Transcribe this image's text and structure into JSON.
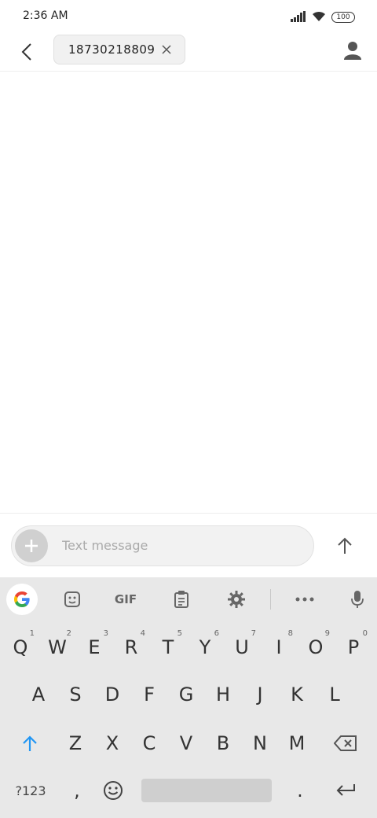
{
  "status": {
    "time": "2:36 AM",
    "battery": "100"
  },
  "header": {
    "recipient": "18730218809"
  },
  "compose": {
    "placeholder": "Text message"
  },
  "keyboard": {
    "toolbar": {
      "gif_label": "GIF"
    },
    "row1": [
      {
        "label": "Q",
        "hint": "1"
      },
      {
        "label": "W",
        "hint": "2"
      },
      {
        "label": "E",
        "hint": "3"
      },
      {
        "label": "R",
        "hint": "4"
      },
      {
        "label": "T",
        "hint": "5"
      },
      {
        "label": "Y",
        "hint": "6"
      },
      {
        "label": "U",
        "hint": "7"
      },
      {
        "label": "I",
        "hint": "8"
      },
      {
        "label": "O",
        "hint": "9"
      },
      {
        "label": "P",
        "hint": "0"
      }
    ],
    "row2": [
      "A",
      "S",
      "D",
      "F",
      "G",
      "H",
      "J",
      "K",
      "L"
    ],
    "row3": [
      "Z",
      "X",
      "C",
      "V",
      "B",
      "N",
      "M"
    ],
    "symbols_label": "?123",
    "comma_label": ",",
    "period_label": "."
  },
  "colors": {
    "accent": "#2196F3",
    "keyboard_bg": "#e8e8e8"
  }
}
